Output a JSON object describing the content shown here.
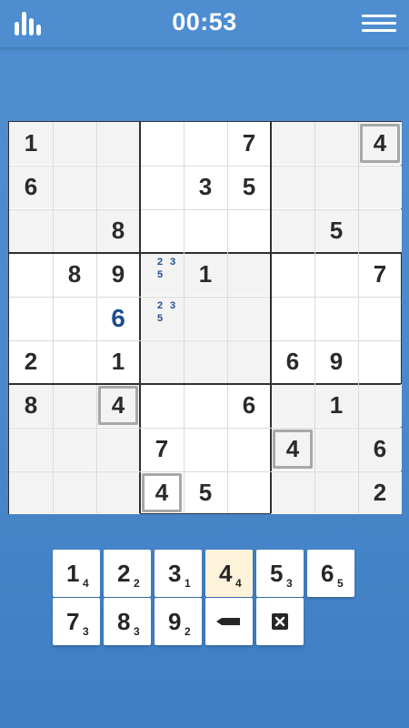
{
  "header": {
    "timer": "00:53",
    "stats_icon": "bar-chart-icon",
    "menu_icon": "hamburger-menu-icon"
  },
  "board": {
    "grid": [
      [
        1,
        0,
        0,
        0,
        0,
        7,
        0,
        0,
        4
      ],
      [
        6,
        0,
        0,
        0,
        3,
        5,
        0,
        0,
        0
      ],
      [
        0,
        0,
        8,
        0,
        0,
        0,
        0,
        5,
        0
      ],
      [
        0,
        8,
        9,
        0,
        1,
        0,
        0,
        0,
        7
      ],
      [
        0,
        0,
        6,
        0,
        0,
        0,
        0,
        0,
        0
      ],
      [
        2,
        0,
        1,
        0,
        0,
        0,
        6,
        9,
        0
      ],
      [
        8,
        0,
        4,
        0,
        0,
        6,
        0,
        1,
        0
      ],
      [
        0,
        0,
        0,
        7,
        0,
        0,
        4,
        0,
        6
      ],
      [
        0,
        0,
        0,
        4,
        5,
        0,
        0,
        0,
        2
      ]
    ],
    "user_entries": [
      [
        4,
        2
      ]
    ],
    "highlighted_cells": [
      [
        0,
        8
      ],
      [
        6,
        2
      ],
      [
        7,
        6
      ],
      [
        8,
        3
      ]
    ],
    "shaded_cells": [
      [
        0,
        0
      ],
      [
        0,
        1
      ],
      [
        0,
        2
      ],
      [
        1,
        0
      ],
      [
        1,
        1
      ],
      [
        1,
        2
      ],
      [
        2,
        0
      ],
      [
        2,
        1
      ],
      [
        2,
        2
      ],
      [
        0,
        6
      ],
      [
        0,
        7
      ],
      [
        0,
        8
      ],
      [
        1,
        6
      ],
      [
        1,
        7
      ],
      [
        1,
        8
      ],
      [
        2,
        6
      ],
      [
        2,
        7
      ],
      [
        2,
        8
      ],
      [
        3,
        3
      ],
      [
        3,
        4
      ],
      [
        3,
        5
      ],
      [
        4,
        3
      ],
      [
        4,
        4
      ],
      [
        4,
        5
      ],
      [
        5,
        3
      ],
      [
        5,
        4
      ],
      [
        5,
        5
      ],
      [
        6,
        0
      ],
      [
        6,
        1
      ],
      [
        6,
        2
      ],
      [
        7,
        0
      ],
      [
        7,
        1
      ],
      [
        7,
        2
      ],
      [
        8,
        0
      ],
      [
        8,
        1
      ],
      [
        8,
        2
      ],
      [
        6,
        6
      ],
      [
        6,
        7
      ],
      [
        6,
        8
      ],
      [
        7,
        6
      ],
      [
        7,
        7
      ],
      [
        7,
        8
      ],
      [
        8,
        6
      ],
      [
        8,
        7
      ],
      [
        8,
        8
      ]
    ],
    "pencil_marks": [
      {
        "row": 3,
        "col": 3,
        "notes": [
          2,
          3,
          5
        ]
      },
      {
        "row": 4,
        "col": 3,
        "notes": [
          2,
          3,
          5
        ]
      }
    ]
  },
  "keypad": {
    "digits": [
      {
        "digit": "1",
        "remaining": "4"
      },
      {
        "digit": "2",
        "remaining": "2"
      },
      {
        "digit": "3",
        "remaining": "1"
      },
      {
        "digit": "4",
        "remaining": "4",
        "active": true
      },
      {
        "digit": "5",
        "remaining": "3"
      },
      {
        "digit": "6",
        "remaining": "5"
      },
      {
        "digit": "7",
        "remaining": "3"
      },
      {
        "digit": "8",
        "remaining": "3"
      },
      {
        "digit": "9",
        "remaining": "2"
      }
    ],
    "pencil_icon": "pencil-icon",
    "erase_icon": "erase-icon"
  },
  "colors": {
    "background": "#4a88cb",
    "user_digit": "#1d4f8f",
    "active_key": "#fdf2da",
    "highlight_border": "#a8a8a8"
  }
}
